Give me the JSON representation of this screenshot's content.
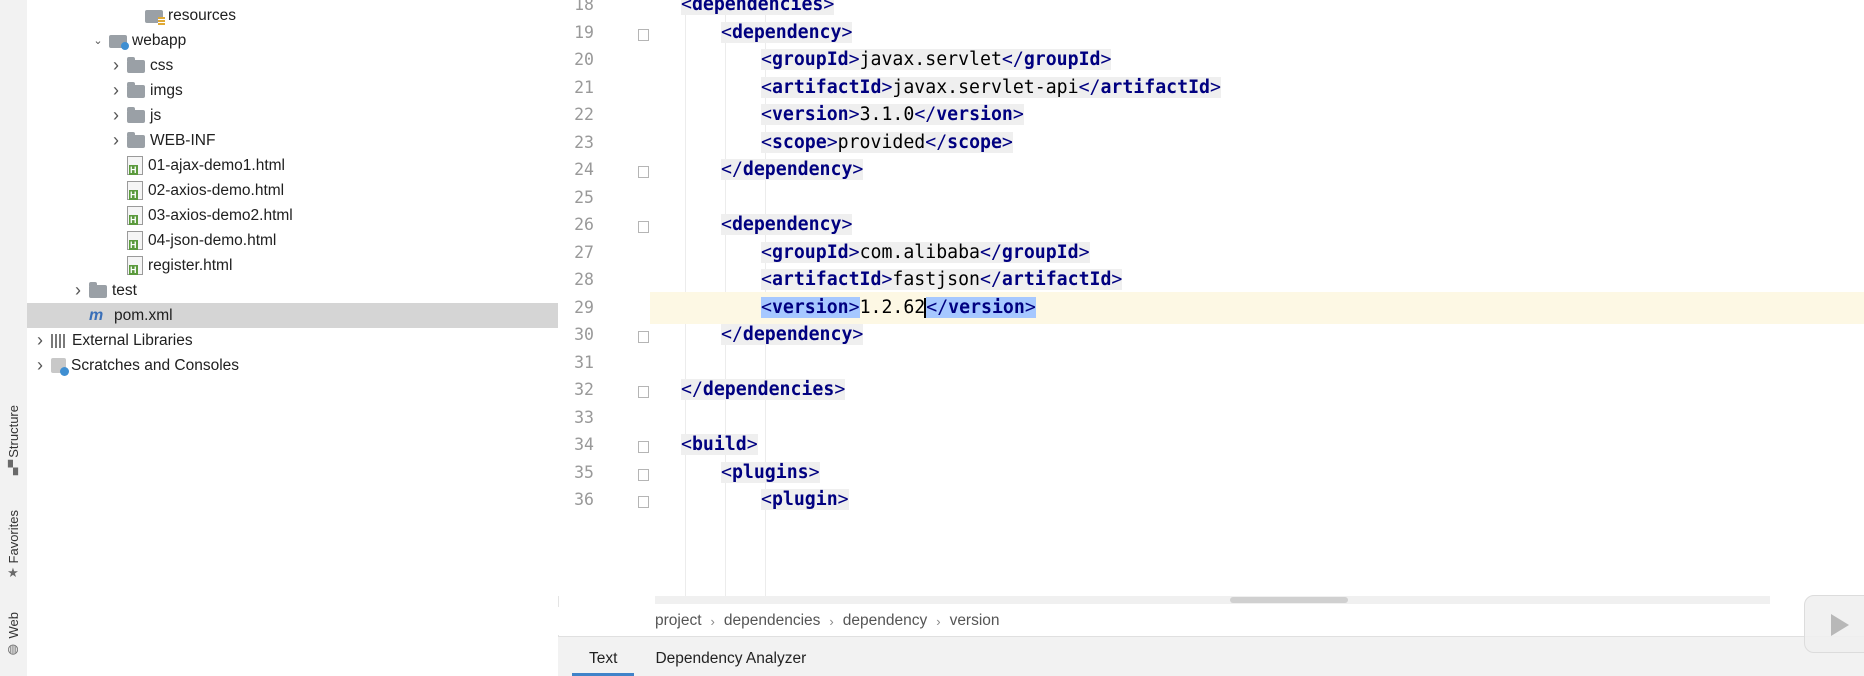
{
  "side_tabs": [
    {
      "label": "Structure",
      "icon": "structure-icon"
    },
    {
      "label": "Favorites",
      "icon": "star-icon"
    },
    {
      "label": "Web",
      "icon": "globe-icon"
    }
  ],
  "tree": [
    {
      "label": "resources",
      "icon": "resources-folder-icon",
      "arrow": ""
    },
    {
      "label": "webapp",
      "icon": "web-folder-icon",
      "arrow": "expanded"
    },
    {
      "label": "css",
      "icon": "folder-icon",
      "arrow": "collapsed"
    },
    {
      "label": "imgs",
      "icon": "folder-icon",
      "arrow": "collapsed"
    },
    {
      "label": "js",
      "icon": "folder-icon",
      "arrow": "collapsed"
    },
    {
      "label": "WEB-INF",
      "icon": "folder-icon",
      "arrow": "collapsed"
    },
    {
      "label": "01-ajax-demo1.html",
      "icon": "html-file-icon",
      "arrow": ""
    },
    {
      "label": "02-axios-demo.html",
      "icon": "html-file-icon",
      "arrow": ""
    },
    {
      "label": "03-axios-demo2.html",
      "icon": "html-file-icon",
      "arrow": ""
    },
    {
      "label": "04-json-demo.html",
      "icon": "html-file-icon",
      "arrow": ""
    },
    {
      "label": "register.html",
      "icon": "html-file-icon",
      "arrow": ""
    },
    {
      "label": "test",
      "icon": "folder-icon",
      "arrow": "collapsed"
    },
    {
      "label": "pom.xml",
      "icon": "maven-icon",
      "arrow": "",
      "selected": true
    },
    {
      "label": "External Libraries",
      "icon": "libraries-icon",
      "arrow": "collapsed"
    },
    {
      "label": "Scratches and Consoles",
      "icon": "scratches-icon",
      "arrow": "collapsed"
    }
  ],
  "editor": {
    "lines": [
      {
        "num": "18",
        "indent": 1,
        "open": "dependencies",
        "text": "",
        "close": "",
        "partial": true
      },
      {
        "num": "19",
        "indent": 2,
        "open": "dependency",
        "text": "",
        "close": "",
        "fold": true
      },
      {
        "num": "20",
        "indent": 3,
        "open": "groupId",
        "text": "javax.servlet",
        "close": "groupId"
      },
      {
        "num": "21",
        "indent": 3,
        "open": "artifactId",
        "text": "javax.servlet-api",
        "close": "artifactId"
      },
      {
        "num": "22",
        "indent": 3,
        "open": "version",
        "text": "3.1.0",
        "close": "version"
      },
      {
        "num": "23",
        "indent": 3,
        "open": "scope",
        "text": "provided",
        "close": "scope"
      },
      {
        "num": "24",
        "indent": 2,
        "open": "",
        "text": "",
        "close": "dependency",
        "fold": true
      },
      {
        "num": "25",
        "indent": 0,
        "open": "",
        "text": "",
        "close": ""
      },
      {
        "num": "26",
        "indent": 2,
        "open": "dependency",
        "text": "",
        "close": "",
        "fold": true
      },
      {
        "num": "27",
        "indent": 3,
        "open": "groupId",
        "text": "com.alibaba",
        "close": "groupId"
      },
      {
        "num": "28",
        "indent": 3,
        "open": "artifactId",
        "text": "fastjson",
        "close": "artifactId"
      },
      {
        "num": "29",
        "indent": 3,
        "open": "version",
        "text": "1.2.62",
        "close": "version",
        "current": true
      },
      {
        "num": "30",
        "indent": 2,
        "open": "",
        "text": "",
        "close": "dependency",
        "fold": true
      },
      {
        "num": "31",
        "indent": 0,
        "open": "",
        "text": "",
        "close": ""
      },
      {
        "num": "32",
        "indent": 1,
        "open": "",
        "text": "",
        "close": "dependencies",
        "fold": true
      },
      {
        "num": "33",
        "indent": 0,
        "open": "",
        "text": "",
        "close": ""
      },
      {
        "num": "34",
        "indent": 1,
        "open": "build",
        "text": "",
        "close": "",
        "fold": true
      },
      {
        "num": "35",
        "indent": 2,
        "open": "plugins",
        "text": "",
        "close": "",
        "fold": true
      },
      {
        "num": "36",
        "indent": 3,
        "open": "plugin",
        "text": "",
        "close": "",
        "fold": true
      }
    ]
  },
  "breadcrumb": [
    "project",
    "dependencies",
    "dependency",
    "version"
  ],
  "bottom_tabs": [
    {
      "label": "Text",
      "active": true
    },
    {
      "label": "Dependency Analyzer",
      "active": false
    }
  ]
}
